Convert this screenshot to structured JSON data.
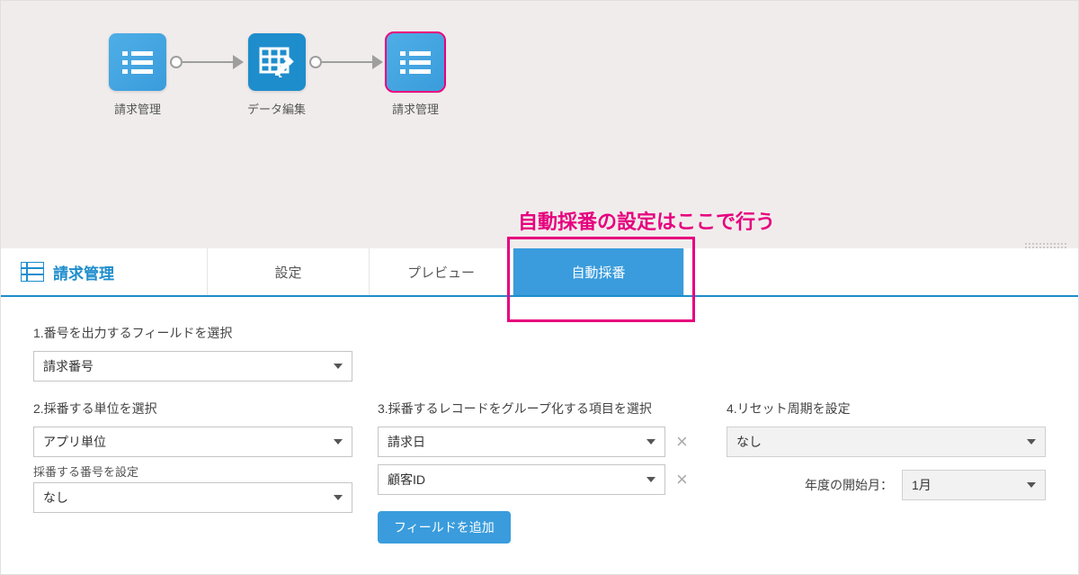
{
  "flow": {
    "nodes": [
      {
        "label": "請求管理",
        "type": "list",
        "style": "blue-light"
      },
      {
        "label": "データ編集",
        "type": "edit",
        "style": "blue-dark"
      },
      {
        "label": "請求管理",
        "type": "list",
        "style": "blue-light",
        "selected": true
      }
    ]
  },
  "annotation": {
    "text": "自動採番の設定はここで行う"
  },
  "header": {
    "title": "請求管理"
  },
  "tabs": {
    "settings": "設定",
    "preview": "プレビュー",
    "auto_number": "自動採番"
  },
  "form": {
    "step1_label": "1.番号を出力するフィールドを選択",
    "step1_value": "請求番号",
    "step2_label": "2.採番する単位を選択",
    "step2_value": "アプリ単位",
    "step2_sub_label": "採番する番号を設定",
    "step2_sub_value": "なし",
    "step3_label": "3.採番するレコードをグループ化する項目を選択",
    "step3_values": [
      "請求日",
      "顧客ID"
    ],
    "step3_add_button": "フィールドを追加",
    "step4_label": "4.リセット周期を設定",
    "step4_value": "なし",
    "step4_start_label": "年度の開始月：",
    "step4_start_value": "1月"
  }
}
